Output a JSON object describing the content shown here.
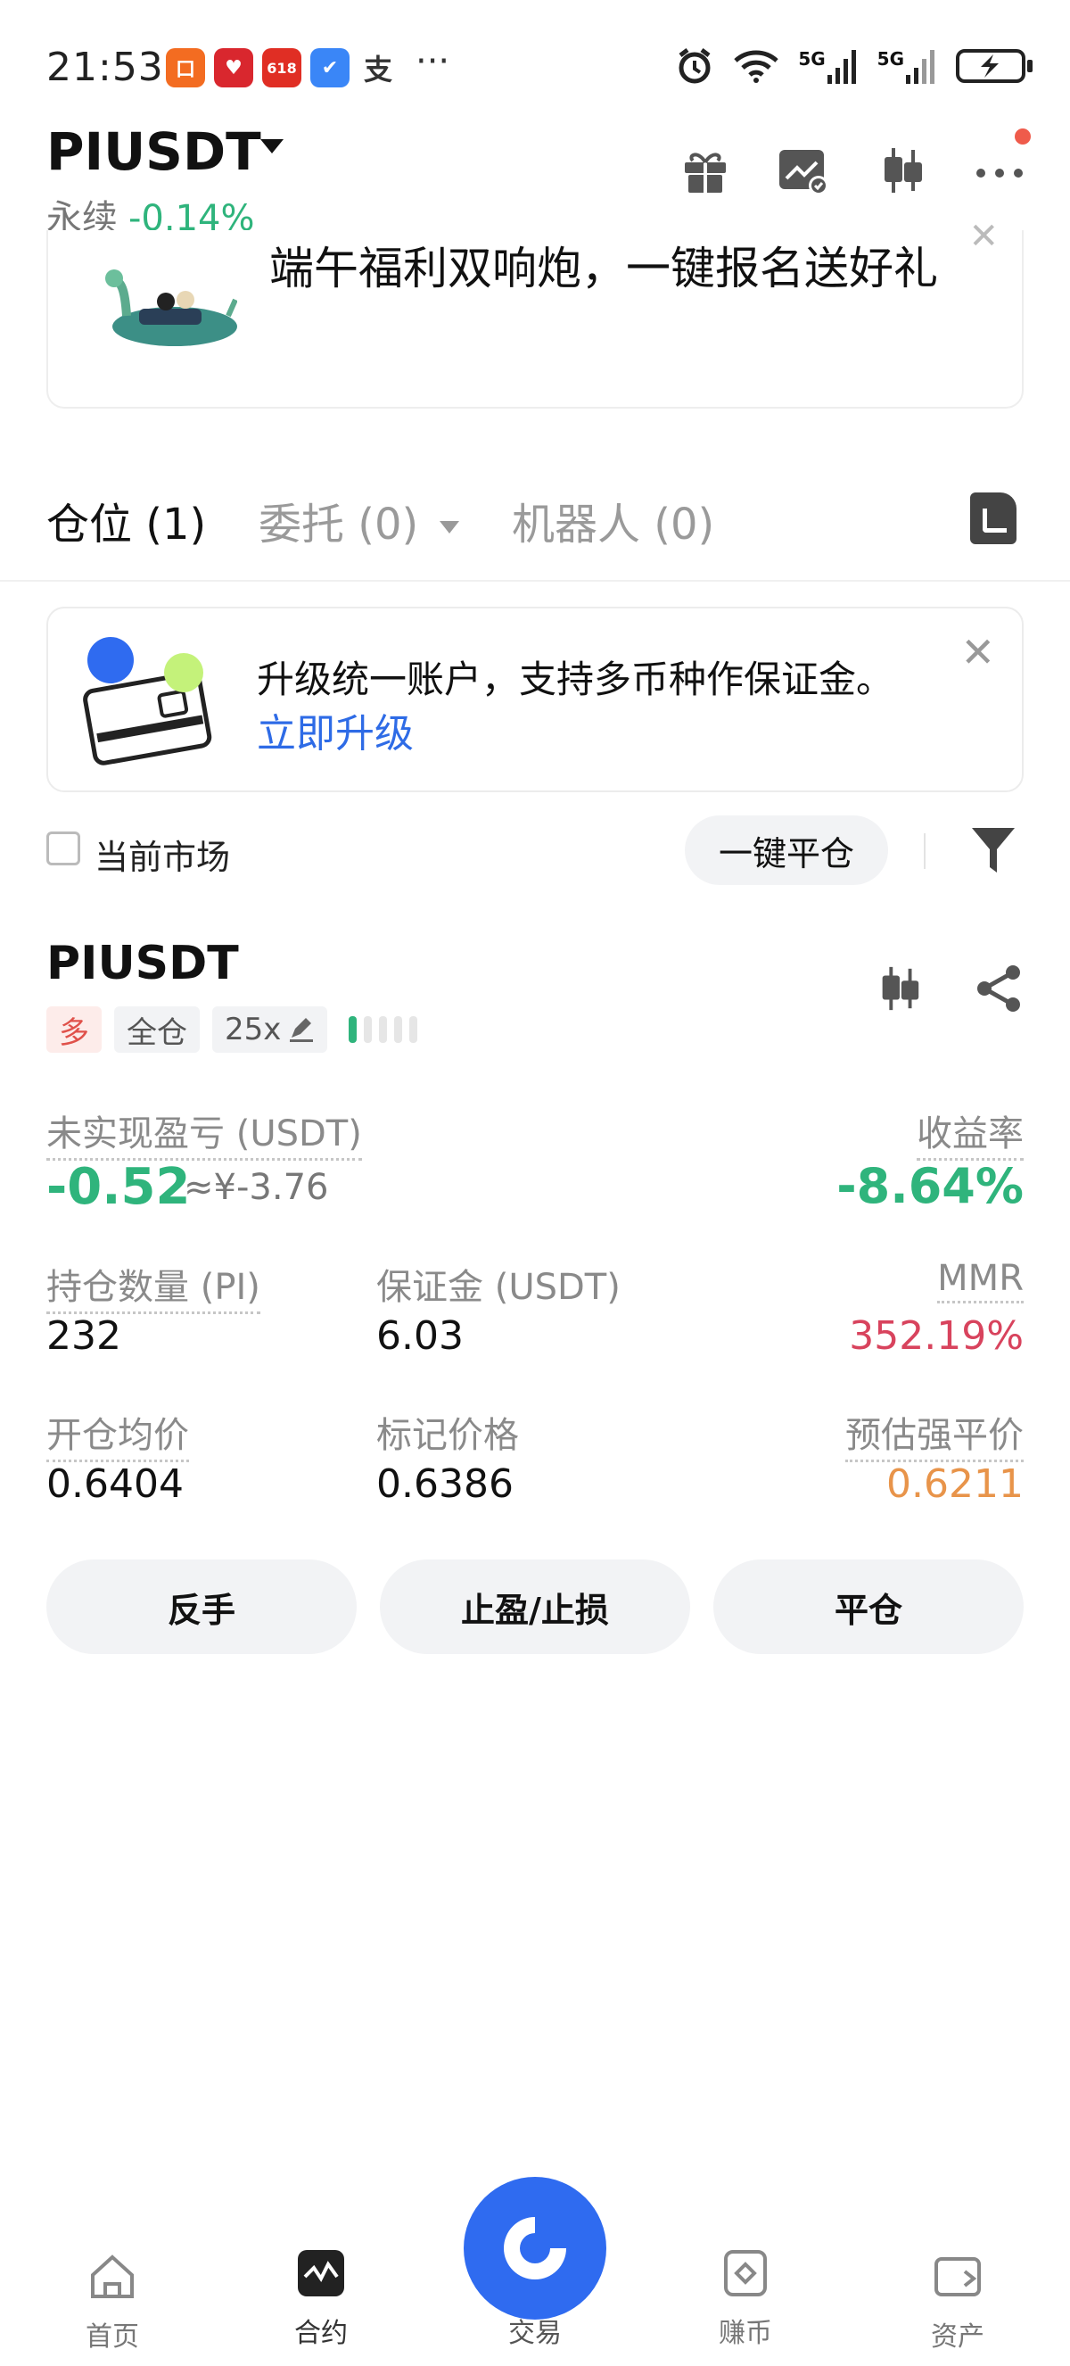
{
  "status_bar": {
    "time": "21:53",
    "apps": [
      {
        "name": "meituan-icon",
        "glyph": "口",
        "color": "#f36c21"
      },
      {
        "name": "jd-icon",
        "glyph": "♥",
        "color": "#d9272e"
      },
      {
        "name": "pdd-icon",
        "glyph": "618",
        "color": "#e02e24"
      },
      {
        "name": "appstore-icon",
        "glyph": "✔",
        "color": "#3a86f7"
      },
      {
        "name": "alipay-icon",
        "glyph": "支",
        "color": "#ffffff"
      }
    ],
    "more": "···",
    "net1": "5G",
    "net2": "5G"
  },
  "header": {
    "symbol": "PIUSDT",
    "type": "永续",
    "change": "-0.14%"
  },
  "banner": {
    "text": "端午福利双响炮，一键报名送好礼"
  },
  "tabs": [
    {
      "label": "仓位 (1)"
    },
    {
      "label": "委托 (0)"
    },
    {
      "label": "机器人 (0)"
    }
  ],
  "upgrade": {
    "message": "升级统一账户，支持多币种作保证金。",
    "link": "立即升级"
  },
  "filters": {
    "current_market": "当前市场",
    "close_all": "一键平仓"
  },
  "position": {
    "symbol": "PIUSDT",
    "side": "多",
    "margin_mode": "全仓",
    "leverage": "25x",
    "leverage_level": 0.2,
    "unrealized_label": "未实现盈亏 (USDT)",
    "unrealized_value": "-0.52",
    "unrealized_cny": "≈¥-3.76",
    "roe_label": "收益率",
    "roe_value": "-8.64%",
    "qty_label": "持仓数量 (PI)",
    "qty_value": "232",
    "margin_label": "保证金 (USDT)",
    "margin_value": "6.03",
    "mmr_label": "MMR",
    "mmr_value": "352.19%",
    "entry_label": "开仓均价",
    "entry_value": "0.6404",
    "mark_label": "标记价格",
    "mark_value": "0.6386",
    "liq_label": "预估强平价",
    "liq_value": "0.6211"
  },
  "actions": {
    "reverse": "反手",
    "tpsl": "止盈/止损",
    "close": "平仓"
  },
  "bottom_nav": {
    "home": "首页",
    "contract": "合约",
    "trade": "交易",
    "earn": "赚币",
    "assets": "资产"
  },
  "colors": {
    "green": "#2fb47c",
    "red": "#e0514a",
    "orange": "#e8944a",
    "mmr": "#d8435d",
    "blue": "#2f6bf0"
  }
}
